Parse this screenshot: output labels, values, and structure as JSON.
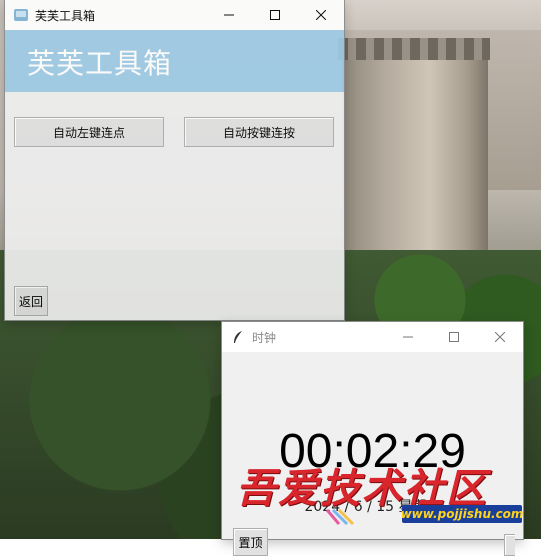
{
  "main_window": {
    "title": "芙芙工具箱",
    "banner_title": "芙芙工具箱",
    "buttons": {
      "auto_left_click": "自动左键连点",
      "auto_key_press": "自动按键连按",
      "back": "返回"
    }
  },
  "clock_window": {
    "title": "时钟",
    "time": "00:02:29",
    "date": "2024 / 6 / 15 星期六",
    "pin_button": "置顶"
  },
  "watermark": {
    "text": "吾爱技术社区",
    "url": "www.pojjishu.com"
  },
  "colors": {
    "banner": "#9ecbe6",
    "window_bg": "#f0f0f0",
    "watermark_red": "#d9252c",
    "watermark_blue": "#1a3f9a",
    "watermark_yellow": "#ffd21c"
  },
  "icons": [
    "app-icon",
    "minimize-icon",
    "maximize-icon",
    "close-icon",
    "feather-icon"
  ]
}
